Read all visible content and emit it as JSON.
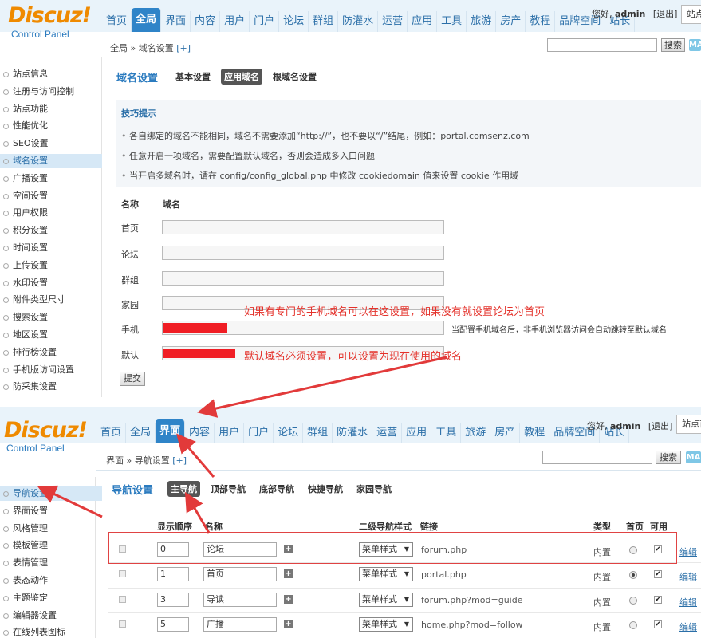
{
  "top": {
    "logo": "Discuz!",
    "logo_sub": "Control Panel",
    "nav": [
      "首页",
      "全局",
      "界面",
      "内容",
      "用户",
      "门户",
      "论坛",
      "群组",
      "防灌水",
      "运营",
      "应用",
      "工具",
      "旅游",
      "房产",
      "教程",
      "品牌空间",
      "站长"
    ],
    "nav_active": "全局",
    "greeting_prefix": "您好, ",
    "user": "admin",
    "logout": "[退出]",
    "site_btn": "站点",
    "breadcrumb": "全局 » 域名设置",
    "breadcrumb_plus": "[+]",
    "search_btn": "搜索",
    "ma": "MA",
    "sidebar": [
      "站点信息",
      "注册与访问控制",
      "站点功能",
      "性能优化",
      "SEO设置",
      "域名设置",
      "广播设置",
      "空间设置",
      "用户权限",
      "积分设置",
      "时间设置",
      "上传设置",
      "水印设置",
      "附件类型尺寸",
      "搜索设置",
      "地区设置",
      "排行榜设置",
      "手机版访问设置",
      "防采集设置"
    ],
    "sidebar_selected": "域名设置",
    "tab_title": "域名设置",
    "tabs": [
      "基本设置",
      "应用域名",
      "根域名设置"
    ],
    "tab_active": "应用域名",
    "tips_title": "技巧提示",
    "tips": [
      "各自绑定的域名不能相同，域名不需要添加“http://”，也不要以“/”结尾，例如：portal.comsenz.com",
      "任意开启一项域名，需要配置默认域名，否则会造成多入口问题",
      "当开启多域名时，请在 config/config_global.php 中修改 cookiedomain 值来设置 cookie 作用域"
    ],
    "col_name": "名称",
    "col_domain": "域名",
    "rows": [
      "首页",
      "论坛",
      "群组",
      "家园",
      "手机",
      "默认"
    ],
    "mobile_hint": "当配置手机域名后，非手机浏览器访问会自动跳转至默认域名",
    "note_mobile": "如果有专门的手机域名可以在这设置，如果没有就设置论坛为首页",
    "note_default": "默认域名必须设置，可以设置为现在使用的域名",
    "submit": "提交"
  },
  "bottom": {
    "logo": "Discuz!",
    "logo_sub": "Control Panel",
    "nav": [
      "首页",
      "全局",
      "界面",
      "内容",
      "用户",
      "门户",
      "论坛",
      "群组",
      "防灌水",
      "运营",
      "应用",
      "工具",
      "旅游",
      "房产",
      "教程",
      "品牌空间",
      "站长"
    ],
    "nav_active": "界面",
    "greeting_prefix": "您好, ",
    "user": "admin",
    "logout": "[退出]",
    "site_btn": "站点首",
    "breadcrumb": "界面 » 导航设置",
    "breadcrumb_plus": "[+]",
    "search_btn": "搜索",
    "ma": "MA",
    "sidebar": [
      "导航设置",
      "界面设置",
      "风格管理",
      "模板管理",
      "表情管理",
      "表态动作",
      "主题鉴定",
      "编辑器设置",
      "在线列表图标"
    ],
    "sidebar_selected": "导航设置",
    "tab_title": "导航设置",
    "tabs": [
      "主导航",
      "顶部导航",
      "底部导航",
      "快捷导航",
      "家园导航"
    ],
    "tab_active": "主导航",
    "headers": {
      "order": "显示顺序",
      "name": "名称",
      "style": "二级导航样式",
      "link": "链接",
      "type": "类型",
      "home": "首页",
      "enabled": "可用"
    },
    "rows": [
      {
        "order": "0",
        "name": "论坛",
        "style": "菜单样式",
        "link": "forum.php",
        "type": "内置",
        "home": false,
        "enabled": true,
        "edit": "编辑"
      },
      {
        "order": "1",
        "name": "首页",
        "style": "菜单样式",
        "link": "portal.php",
        "type": "内置",
        "home": true,
        "enabled": true,
        "edit": "编辑"
      },
      {
        "order": "3",
        "name": "导读",
        "style": "菜单样式",
        "link": "forum.php?mod=guide",
        "type": "内置",
        "home": false,
        "enabled": true,
        "edit": "编辑"
      },
      {
        "order": "5",
        "name": "广播",
        "style": "菜单样式",
        "link": "home.php?mod=follow",
        "type": "内置",
        "home": false,
        "enabled": true,
        "edit": "编辑"
      }
    ]
  }
}
